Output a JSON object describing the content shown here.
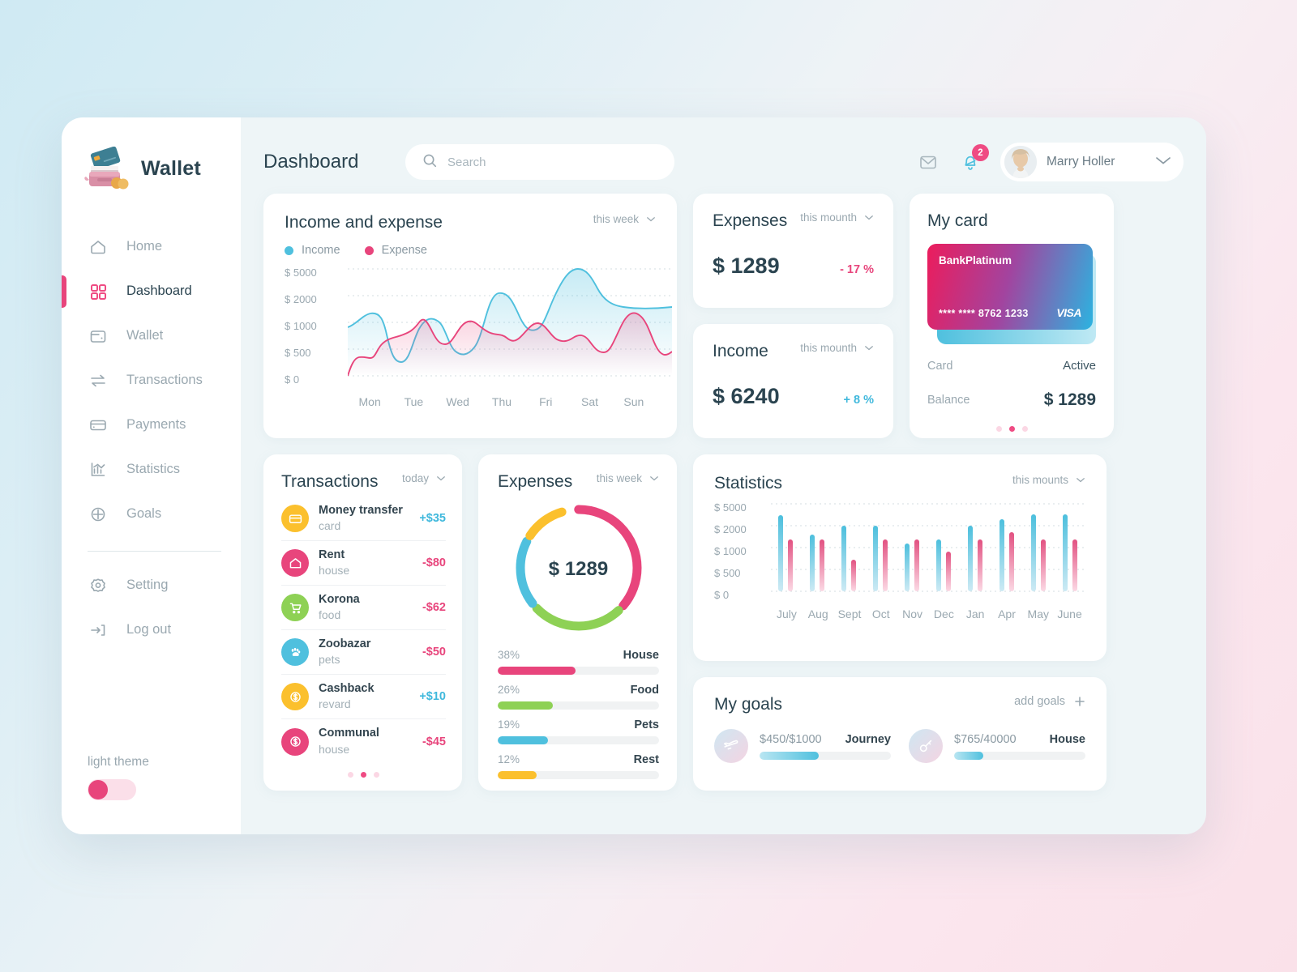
{
  "brand": {
    "name": "Wallet",
    "logo_icon": "wallet-illustration"
  },
  "sidebar": {
    "items": [
      {
        "label": "Home",
        "icon": "home-icon",
        "active": false
      },
      {
        "label": "Dashboard",
        "icon": "grid-icon",
        "active": true
      },
      {
        "label": "Wallet",
        "icon": "wallet-icon",
        "active": false
      },
      {
        "label": "Transactions",
        "icon": "transfer-arrows-icon",
        "active": false
      },
      {
        "label": "Payments",
        "icon": "card-icon",
        "active": false
      },
      {
        "label": "Statistics",
        "icon": "chart-icon",
        "active": false
      },
      {
        "label": "Goals",
        "icon": "target-icon",
        "active": false
      }
    ],
    "footer_items": [
      {
        "label": "Setting",
        "icon": "gear-icon"
      },
      {
        "label": "Log out",
        "icon": "logout-icon"
      }
    ],
    "theme": {
      "label": "light theme",
      "enabled": true
    }
  },
  "header": {
    "title": "Dashboard",
    "search_placeholder": "Search",
    "search_value": "",
    "mail_icon": "envelope-icon",
    "bell_icon": "bell-icon",
    "notification_count": "2",
    "user_name": "Marry Holler"
  },
  "income_expense": {
    "title": "Income and expense",
    "period": "this week",
    "legend": [
      {
        "label": "Income",
        "color": "#4fc0de"
      },
      {
        "label": "Expense",
        "color": "#e8457c"
      }
    ]
  },
  "expenses_stat": {
    "title": "Expenses",
    "period": "this mounth",
    "value": "$ 1289",
    "delta": "- 17 %",
    "delta_sign": "neg"
  },
  "income_stat": {
    "title": "Income",
    "period": "this mounth",
    "value": "$ 6240",
    "delta": "+ 8 %",
    "delta_sign": "pos"
  },
  "my_card": {
    "title": "My card",
    "bank": "BankPlatinum",
    "number": "**** **** 8762 1233",
    "network": "VISA",
    "rows": [
      {
        "key": "Card",
        "value": "Active"
      },
      {
        "key": "Balance",
        "value": "$ 1289"
      }
    ],
    "slide_count": 3,
    "active_slide": 1
  },
  "transactions": {
    "title": "Transactions",
    "period": "today",
    "items": [
      {
        "name": "Money transfer",
        "category": "card",
        "amount": "+$35",
        "positive": true,
        "color": "#fbc02d",
        "icon": "card-icon"
      },
      {
        "name": "Rent",
        "category": "house",
        "amount": "-$80",
        "positive": false,
        "color": "#e8457c",
        "icon": "home-icon"
      },
      {
        "name": "Korona",
        "category": "food",
        "amount": "-$62",
        "positive": false,
        "color": "#8ed155",
        "icon": "cart-icon"
      },
      {
        "name": "Zoobazar",
        "category": "pets",
        "amount": "-$50",
        "positive": false,
        "color": "#4fc0de",
        "icon": "paw-icon"
      },
      {
        "name": "Cashback",
        "category": "revard",
        "amount": "+$10",
        "positive": true,
        "color": "#fbc02d",
        "icon": "dollar-icon"
      },
      {
        "name": "Communal",
        "category": "house",
        "amount": "-$45",
        "positive": false,
        "color": "#e8457c",
        "icon": "dollar-icon"
      }
    ],
    "slide_count": 3,
    "active_slide": 1
  },
  "expenses_breakdown": {
    "title": "Expenses",
    "period": "this week",
    "center_value": "$ 1289",
    "items": [
      {
        "label": "House",
        "pct": "38%",
        "value": 38,
        "color": "#e8457c"
      },
      {
        "label": "Food",
        "pct": "26%",
        "value": 26,
        "color": "#8ed155"
      },
      {
        "label": "Pets",
        "pct": "19%",
        "value": 19,
        "color": "#4fc0de"
      },
      {
        "label": "Rest",
        "pct": "12%",
        "value": 12,
        "color": "#fbc02d"
      }
    ]
  },
  "statistics": {
    "title": "Statistics",
    "period": "this mounts"
  },
  "goals": {
    "title": "My goals",
    "add_label": "add goals",
    "add_icon": "plus-icon",
    "items": [
      {
        "name": "Journey",
        "amount": "$450/$1000",
        "icon": "plane-icon",
        "pct": 45
      },
      {
        "name": "House",
        "amount": "$765/40000",
        "icon": "key-icon",
        "pct": 22
      }
    ]
  },
  "chart_data": [
    {
      "type": "area",
      "title": "Income and expense",
      "x": [
        "Mon",
        "Tue",
        "Wed",
        "Thu",
        "Fri",
        "Sat",
        "Sun"
      ],
      "ytick_labels": [
        "$ 5000",
        "$ 2000",
        "$ 1000",
        "$ 500",
        "$ 0"
      ],
      "ylim": [
        0,
        5000
      ],
      "grid": true,
      "legend_position": "top-left",
      "series": [
        {
          "name": "Income",
          "color": "#4fc0de",
          "values": [
            1000,
            1300,
            500,
            1200,
            700,
            2500,
            1000,
            5000,
            2100,
            1800
          ]
        },
        {
          "name": "Expense",
          "color": "#e8457c",
          "values": [
            0,
            430,
            400,
            800,
            1250,
            700,
            1250,
            1000,
            850,
            1200,
            500
          ]
        }
      ]
    },
    {
      "type": "pie",
      "title": "Expenses",
      "center_label": "$ 1289",
      "labels": [
        "House",
        "Food",
        "Pets",
        "Rest"
      ],
      "values": [
        38,
        26,
        19,
        12
      ],
      "colors": [
        "#e8457c",
        "#8ed155",
        "#4fc0de",
        "#fbc02d"
      ]
    },
    {
      "type": "bar",
      "title": "Statistics",
      "categories": [
        "July",
        "Aug",
        "Sept",
        "Oct",
        "Nov",
        "Dec",
        "Jan",
        "Apr",
        "May",
        "June"
      ],
      "ytick_labels": [
        "$ 5000",
        "$ 2000",
        "$ 1000",
        "$ 500",
        "$ 0"
      ],
      "ylim": [
        0,
        5000
      ],
      "grid": true,
      "series": [
        {
          "name": "Income",
          "color": "#4fc0de",
          "values": [
            3000,
            1700,
            2000,
            2000,
            1300,
            1500,
            2000,
            2600,
            3000,
            3000
          ]
        },
        {
          "name": "Expense",
          "color": "#e8457c",
          "values": [
            1500,
            1500,
            800,
            1500,
            1500,
            1000,
            1500,
            1900,
            1500,
            1500
          ]
        }
      ]
    }
  ]
}
